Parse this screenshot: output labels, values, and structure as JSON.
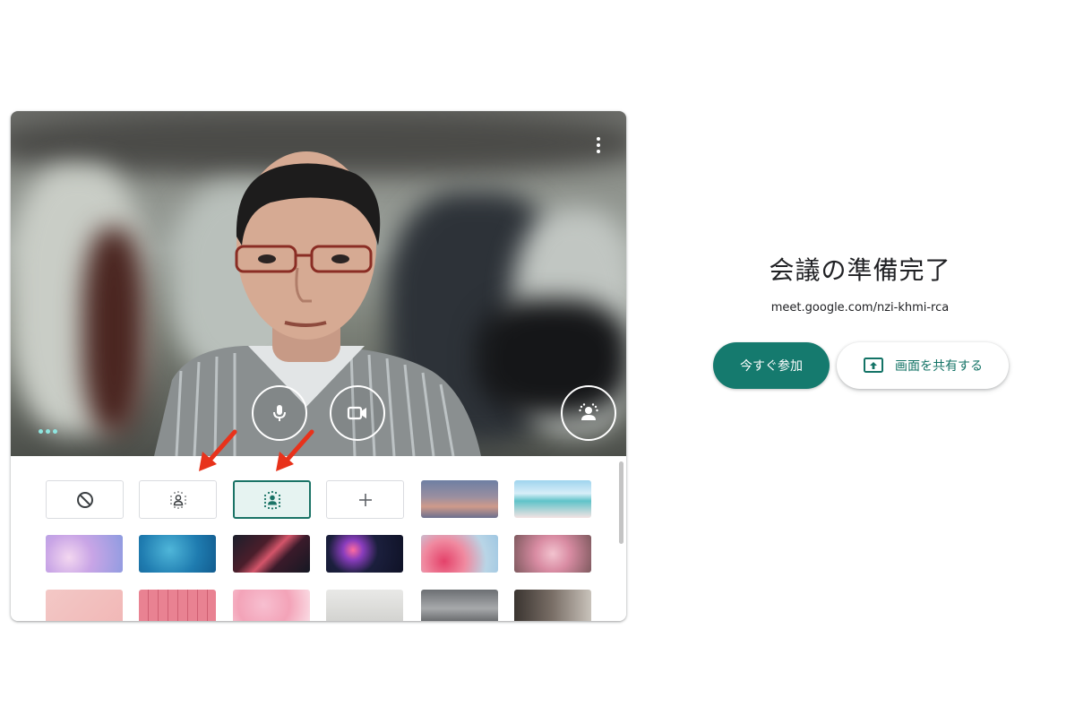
{
  "right_panel": {
    "title": "会議の準備完了",
    "meeting_url": "meet.google.com/nzi-khmi-rca",
    "join_label": "今すぐ参加",
    "present_label": "画面を共有する"
  },
  "preview": {
    "icons": [
      "more-vert-icon",
      "microphone-icon",
      "camera-icon",
      "background-effects-icon",
      "dots-indicator-icon"
    ]
  },
  "background_panel": {
    "options": [
      {
        "name": "no-background",
        "icon": "no-entry-icon",
        "selected": false
      },
      {
        "name": "slight-blur",
        "icon": "blur-person-light-icon",
        "selected": false
      },
      {
        "name": "blur",
        "icon": "blur-person-strong-icon",
        "selected": true
      },
      {
        "name": "add-background",
        "icon": "plus-icon",
        "selected": false
      }
    ],
    "thumbnails": [
      "sunset",
      "beach",
      "pastel-clouds",
      "pool-water",
      "nebula",
      "fireworks",
      "flowers-sky",
      "pink-blossoms",
      "pink-confetti",
      "pink-grid",
      "floral",
      "white-room",
      "gray-room",
      "dark-room"
    ]
  },
  "colors": {
    "accent": "#157a6e",
    "selected_bg": "#e6f3f1",
    "arrow": "#e8321b"
  }
}
